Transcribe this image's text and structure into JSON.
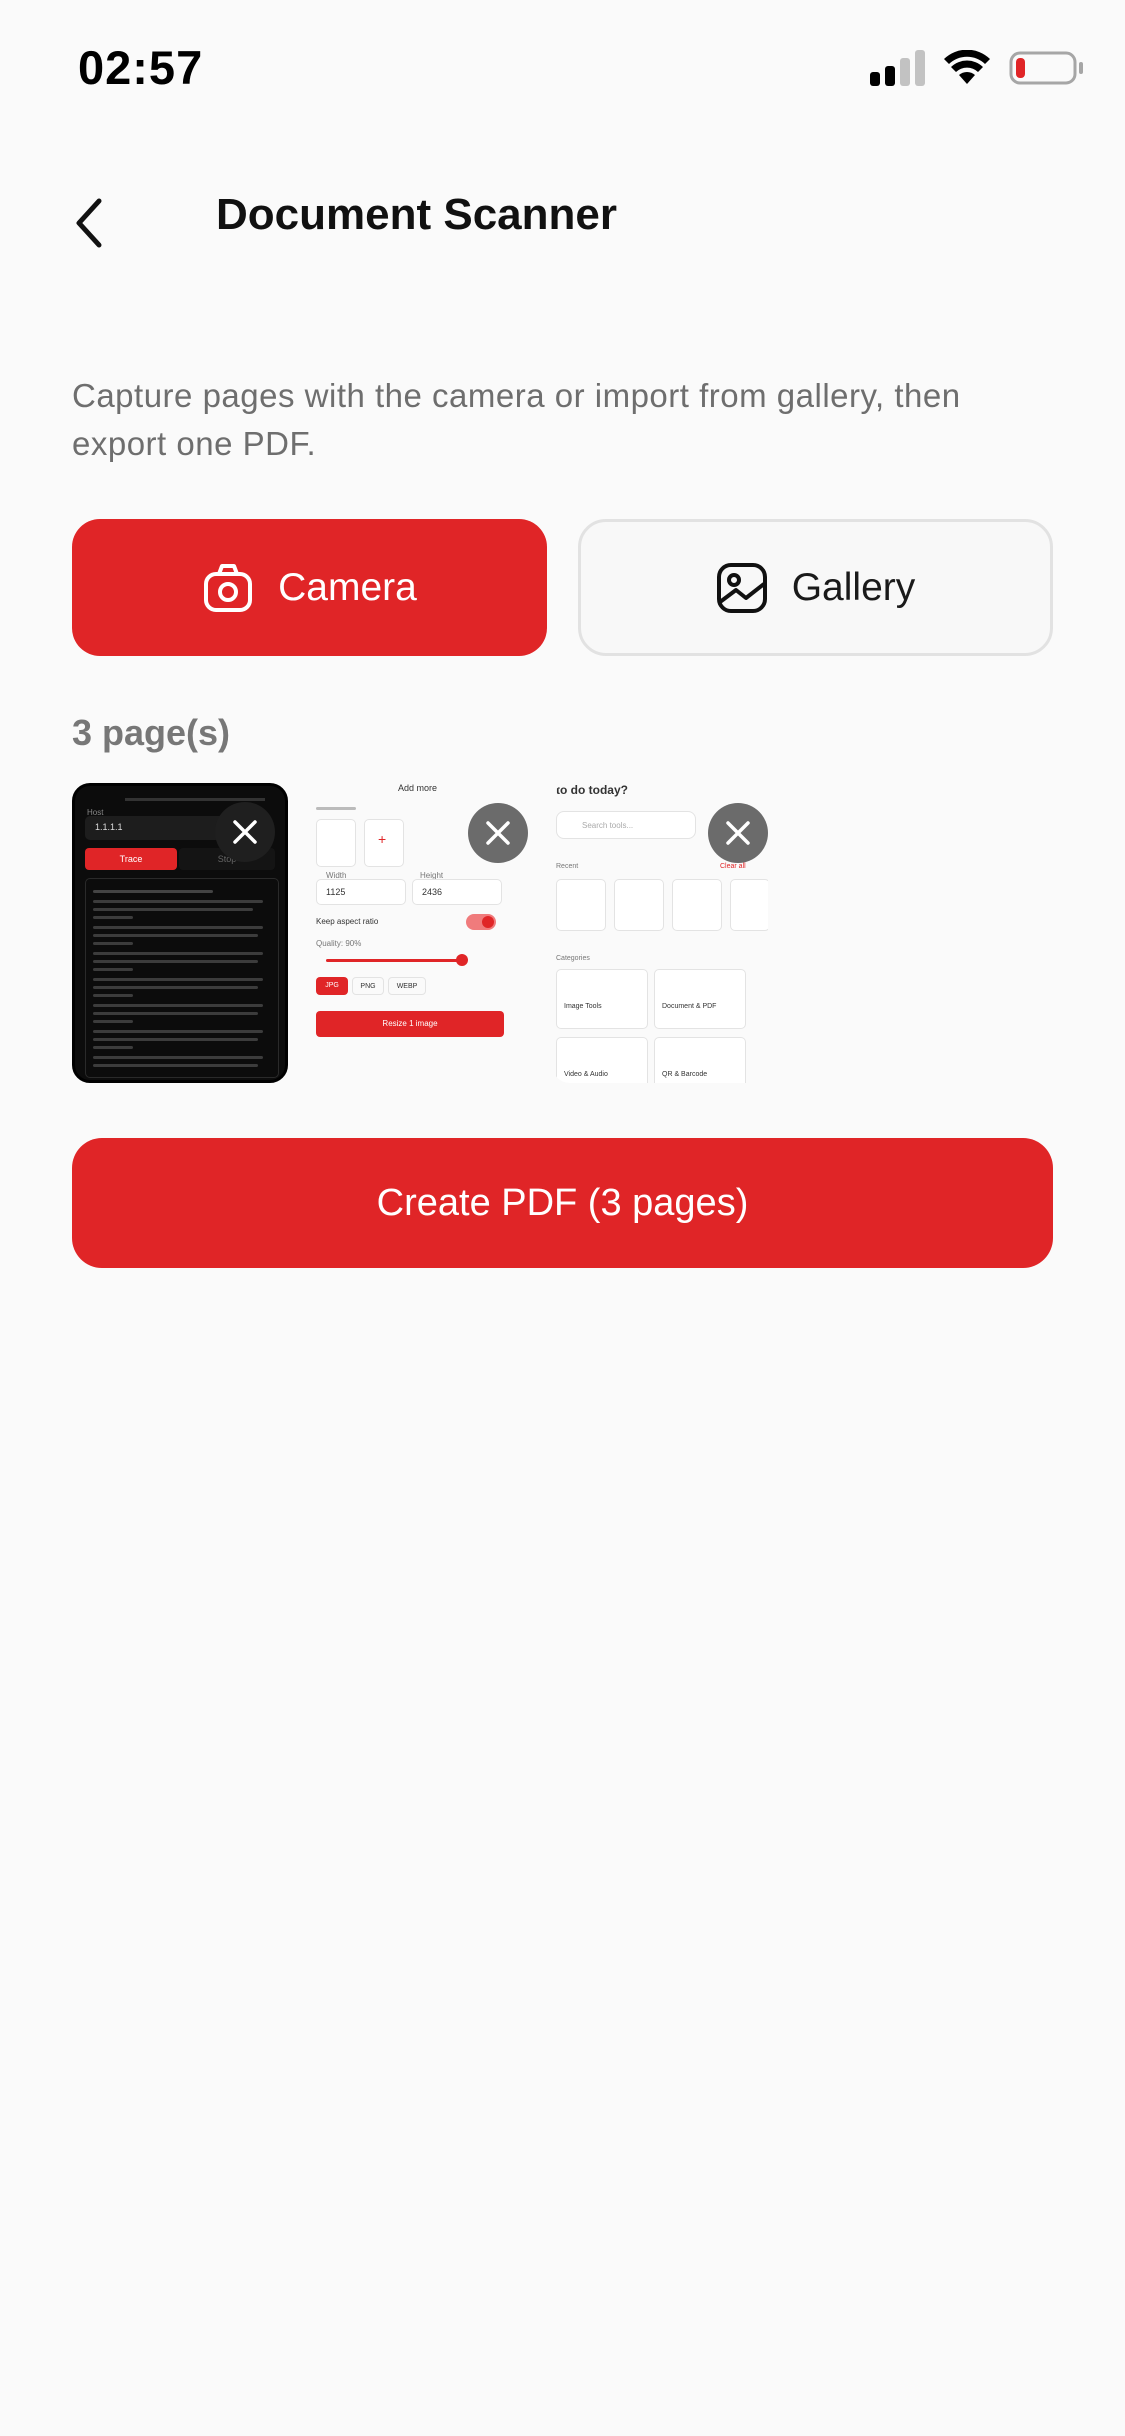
{
  "status_bar": {
    "time": "02:57"
  },
  "nav": {
    "title": "Document Scanner"
  },
  "description": "Capture pages with the camera or import from gallery, then export one PDF.",
  "actions": {
    "camera_label": "Camera",
    "gallery_label": "Gallery"
  },
  "pages": {
    "count_label": "3 page(s)",
    "thumbnails": [
      {
        "host_label": "Host",
        "host_value": "1.1.1.1",
        "trace_label": "Trace",
        "stop_label": "Stop"
      },
      {
        "add_more": "Add more",
        "width_label": "Width",
        "width_value": "1125",
        "height_label": "Height",
        "height_value": "2436",
        "keep_aspect": "Keep aspect ratio",
        "quality": "Quality: 90%",
        "formats": [
          "JPG",
          "PNG",
          "WEBP"
        ],
        "resize_button": "Resize 1 image"
      },
      {
        "heading": "to do today?",
        "search_placeholder": "Search tools...",
        "recent": "Recent",
        "clear_all": "Clear all",
        "categories": "Categories",
        "cat_image": "Image Tools",
        "cat_doc": "Document & PDF",
        "cat_video": "Video & Audio",
        "cat_qr": "QR & Barcode"
      }
    ]
  },
  "create_button": "Create PDF (3 pages)",
  "colors": {
    "accent": "#e02527",
    "muted_text": "#6e6e6e"
  },
  "icons": [
    "back-chevron-icon",
    "camera-icon",
    "gallery-icon",
    "close-icon",
    "signal-icon",
    "wifi-icon",
    "battery-icon"
  ]
}
